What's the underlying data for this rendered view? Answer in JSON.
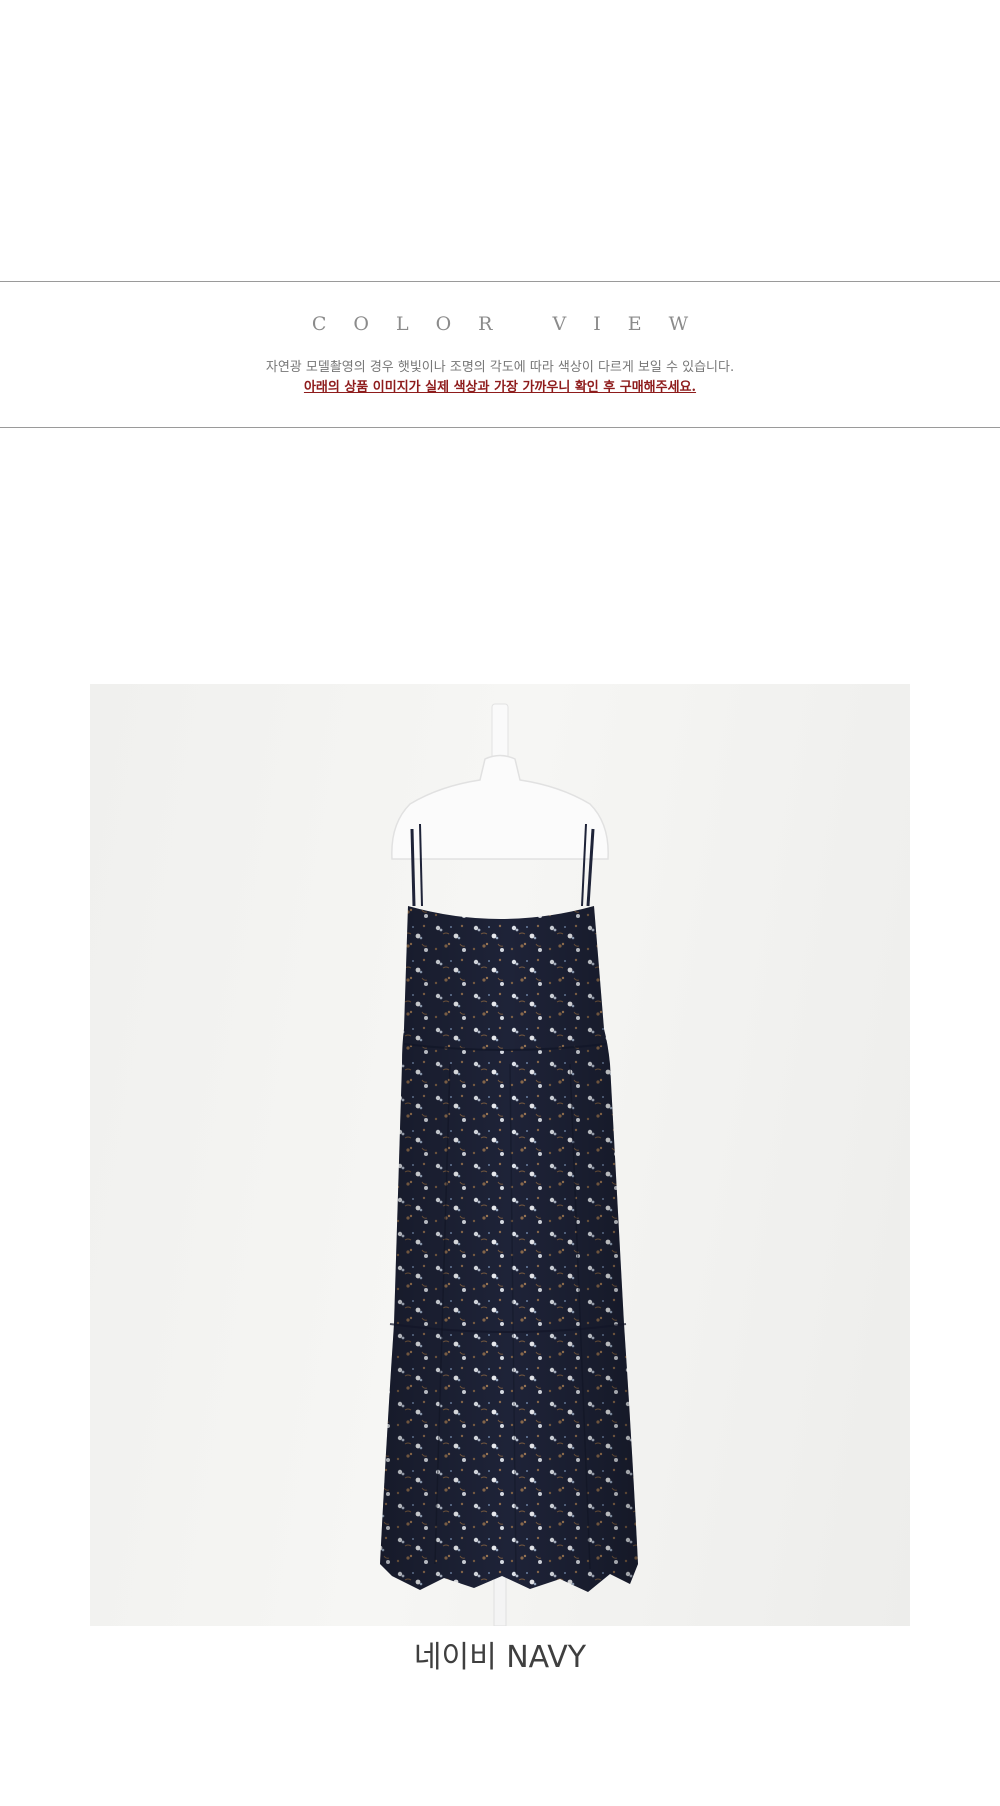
{
  "header": {
    "title": "COLOR VIEW",
    "notice_line1": "자연광 모델촬영의 경우 햇빛이나 조명의 각도에 따라 색상이 다르게 보일 수 있습니다.",
    "notice_line2": "아래의 상품 이미지가 실제 색상과 가장 가까우니 확인 후 구매해주세요."
  },
  "product": {
    "image_subject": "navy floral slip dress on white mannequin",
    "caption": "네이비 NAVY"
  },
  "colors": {
    "notice_red": "#8e1c1c",
    "title_gray": "#8b8b8b",
    "dress_navy": "#1e2338"
  }
}
